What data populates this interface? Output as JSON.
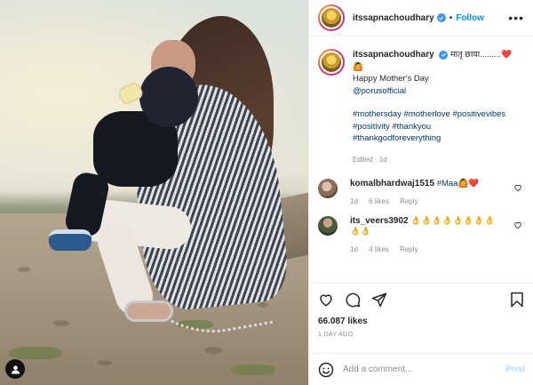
{
  "post": {
    "author": "itssapnachoudhary",
    "follow_label": "Follow",
    "more_label": "•••",
    "separator": "•"
  },
  "caption": {
    "username": "itssapnachoudhary",
    "line1": "मातृ छाया.........❤️",
    "line2": "🙆",
    "line3": "Happy Mother's Day",
    "mention": "@porusofficial",
    "hashtags_1": "#mothersday #motherlove #positivevibes",
    "hashtags_2": "#positivity #thankyou",
    "hashtags_3": "#thankgodforeverything",
    "edited": "Edited · 1d"
  },
  "comments": [
    {
      "username": "komalbhardwaj1515",
      "text": "#Maa🙆❤️",
      "age": "1d",
      "likes": "6 likes",
      "reply": "Reply"
    },
    {
      "username": "its_veers3902",
      "text": "👌👌👌👌👌👌👌👌👌👌",
      "age": "1d",
      "likes": "4 likes",
      "reply": "Reply"
    }
  ],
  "stats": {
    "likes": "66.087 likes",
    "date": "1 DAY AGO"
  },
  "composer": {
    "placeholder": "Add a comment...",
    "post_label": "Post"
  },
  "icons": [
    "user-tag-icon",
    "verified-icon",
    "heart-icon",
    "comment-icon",
    "share-icon",
    "bookmark-icon",
    "smile-icon"
  ],
  "colors": {
    "link_blue": "#0095f6",
    "verified_blue": "#3897f0",
    "muted_gray": "#8e8e8e",
    "hashtag_navy": "#00376b",
    "post_disabled": "#b2dffc"
  }
}
